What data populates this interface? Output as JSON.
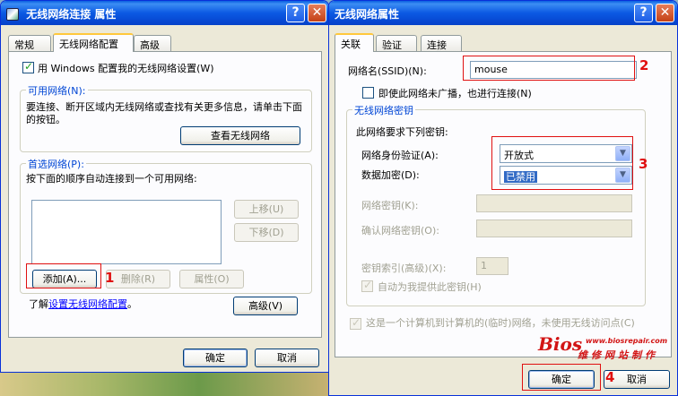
{
  "colors": {
    "accent": "#0046d5",
    "annotation": "#e01010",
    "titlebar": "#0b59e3",
    "window_bg": "#ece9d8"
  },
  "left_window": {
    "title": "无线网络连接 属性",
    "tabs": [
      "常规",
      "无线网络配置",
      "高级"
    ],
    "use_windows_checkbox": "用 Windows 配置我的无线网络设置(W)",
    "available_group_title": "可用网络(N):",
    "available_desc": "要连接、断开区域内无线网络或查找有关更多信息，请单击下面的按钮。",
    "view_networks_button": "查看无线网络",
    "preferred_group_title": "首选网络(P):",
    "preferred_desc": "按下面的顺序自动连接到一个可用网络:",
    "move_up_button": "上移(U)",
    "move_down_button": "下移(D)",
    "add_button": "添加(A)...",
    "remove_button": "删除(R)",
    "properties_button": "属性(O)",
    "learn_prefix": "了解",
    "learn_link": "设置无线网络配置",
    "learn_suffix": "。",
    "advanced_button": "高级(V)",
    "ok_button": "确定",
    "cancel_button": "取消"
  },
  "right_window": {
    "title": "无线网络属性",
    "tabs": [
      "关联",
      "验证",
      "连接"
    ],
    "ssid_label": "网络名(SSID)(N):",
    "ssid_value": "mouse",
    "broadcast_checkbox": "即使此网络未广播，也进行连接(N)",
    "key_group_title": "无线网络密钥",
    "key_required": "此网络要求下列密钥:",
    "auth_label": "网络身份验证(A):",
    "auth_value": "开放式",
    "encryption_label": "数据加密(D):",
    "encryption_value": "已禁用",
    "network_key_label": "网络密钥(K):",
    "confirm_key_label": "确认网络密钥(O):",
    "key_index_label": "密钥索引(高级)(X):",
    "key_index_value": "1",
    "auto_key_checkbox": "自动为我提供此密钥(H)",
    "adhoc_checkbox": "这是一个计算机到计算机的(临时)网络，未使用无线访问点(C)",
    "ok_button": "确定",
    "cancel_button": "取消"
  },
  "annotations": [
    "1",
    "2",
    "3",
    "4"
  ],
  "watermark": {
    "brand": "Bios",
    "url": "www.biosrepair.com",
    "tagline": "维修网站制作"
  }
}
